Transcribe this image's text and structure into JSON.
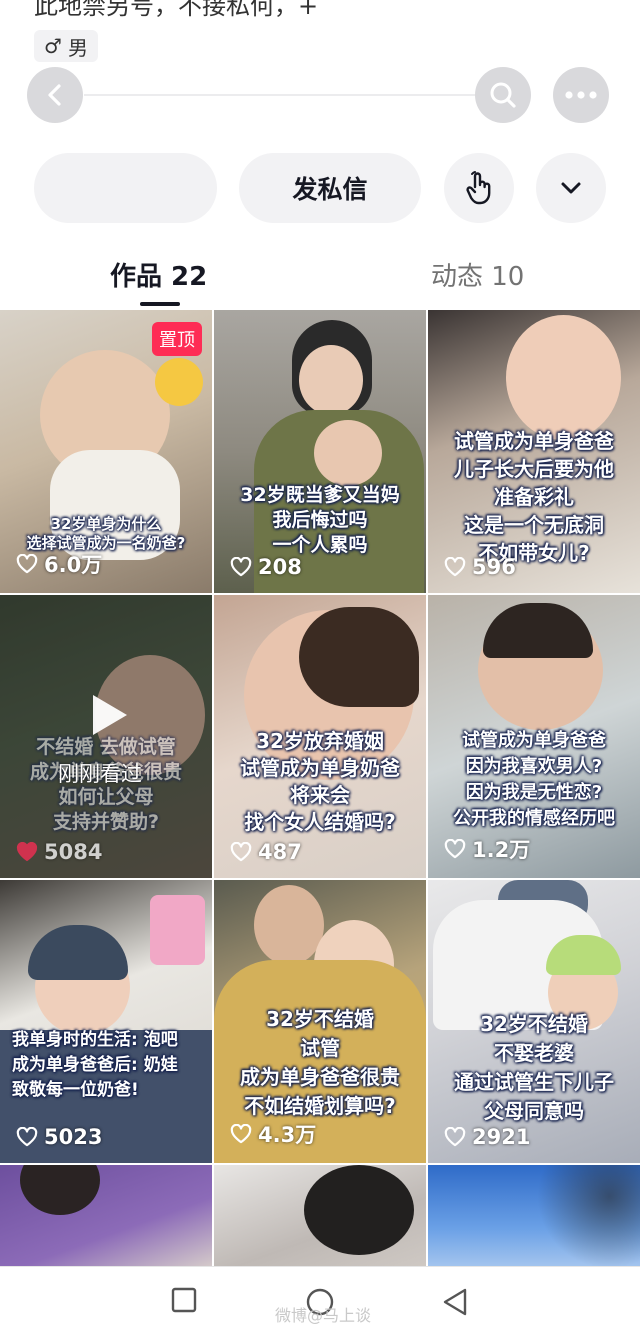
{
  "profile": {
    "bio_cut": "此地禁另号，不接私何，+",
    "gender_symbol": "♂",
    "gender_label": "男"
  },
  "actions": {
    "message_label": "发私信"
  },
  "tabs": {
    "works": "作品 22",
    "dynamic": "动态 10"
  },
  "videos": [
    {
      "caption": [
        "32岁单身为什么",
        "选择试管成为一名奶爸?"
      ],
      "likes": "6.0万",
      "pinned": true,
      "pin_label": "置顶"
    },
    {
      "caption": [
        "32岁既当爹又当妈",
        "我后悔过吗",
        "一个人累吗"
      ],
      "likes": "208"
    },
    {
      "caption": [
        "试管成为单身爸爸",
        "儿子长大后要为他",
        "准备彩礼",
        "这是一个无底洞",
        "不如带女儿?"
      ],
      "likes": "596"
    },
    {
      "caption": [
        "不结婚 去做试管",
        "成为单身爸爸很贵",
        "如何让父母",
        "支持并赞助?"
      ],
      "likes": "5084",
      "watched_label": "刚刚看过",
      "liked": true
    },
    {
      "caption": [
        "32岁放弃婚姻",
        "试管成为单身奶爸",
        "将来会",
        "找个女人结婚吗?"
      ],
      "likes": "487"
    },
    {
      "caption": [
        "试管成为单身爸爸",
        "因为我喜欢男人?",
        "因为我是无性恋?",
        "公开我的情感经历吧"
      ],
      "likes": "1.2万"
    },
    {
      "caption": [
        "我单身时的生活: 泡吧",
        "成为单身爸爸后: 奶娃",
        "致敬每一位奶爸!"
      ],
      "likes": "5023"
    },
    {
      "caption": [
        "32岁不结婚",
        "试管",
        "成为单身爸爸很贵",
        "不如结婚划算吗?"
      ],
      "likes": "4.3万"
    },
    {
      "caption": [
        "32岁不结婚",
        "不娶老婆",
        "通过试管生下儿子",
        "父母同意吗"
      ],
      "likes": "2921"
    }
  ],
  "watermark": "微博@马上谈",
  "icons": {
    "back": "chevron-left-icon",
    "search": "search-icon",
    "more": "more-dots-icon",
    "share": "hand-pointer-icon",
    "expand": "chevron-down-icon",
    "like": "heart-icon"
  },
  "colors": {
    "accent": "#fe2c55",
    "text": "#161823",
    "muted": "#737373",
    "button_bg": "#f2f2f4"
  }
}
